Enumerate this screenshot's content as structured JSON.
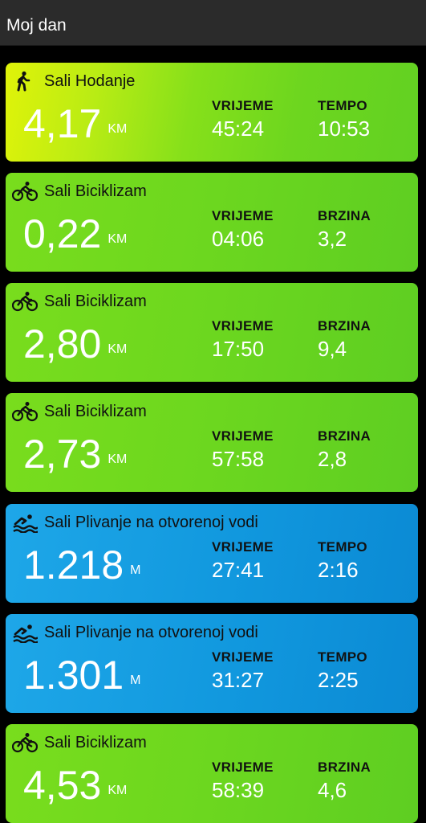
{
  "header": {
    "title": "Moj dan"
  },
  "activities": [
    {
      "type": "walk",
      "icon": "walking-icon",
      "name": "Sali Hodanje",
      "distance": "4,17",
      "unit": "KM",
      "stat1_label": "VRIJEME",
      "stat1_value": "45:24",
      "stat2_label": "TEMPO",
      "stat2_value": "10:53"
    },
    {
      "type": "bike",
      "icon": "cycling-icon",
      "name": "Sali Biciklizam",
      "distance": "0,22",
      "unit": "KM",
      "stat1_label": "VRIJEME",
      "stat1_value": "04:06",
      "stat2_label": "BRZINA",
      "stat2_value": "3,2"
    },
    {
      "type": "bike",
      "icon": "cycling-icon",
      "name": "Sali Biciklizam",
      "distance": "2,80",
      "unit": "KM",
      "stat1_label": "VRIJEME",
      "stat1_value": "17:50",
      "stat2_label": "BRZINA",
      "stat2_value": "9,4"
    },
    {
      "type": "bike",
      "icon": "cycling-icon",
      "name": "Sali Biciklizam",
      "distance": "2,73",
      "unit": "KM",
      "stat1_label": "VRIJEME",
      "stat1_value": "57:58",
      "stat2_label": "BRZINA",
      "stat2_value": "2,8"
    },
    {
      "type": "swim",
      "icon": "swimming-icon",
      "name": "Sali Plivanje na otvorenoj vodi",
      "distance": "1.218",
      "unit": "M",
      "stat1_label": "VRIJEME",
      "stat1_value": "27:41",
      "stat2_label": "TEMPO",
      "stat2_value": "2:16"
    },
    {
      "type": "swim",
      "icon": "swimming-icon",
      "name": "Sali Plivanje na otvorenoj vodi",
      "distance": "1.301",
      "unit": "M",
      "stat1_label": "VRIJEME",
      "stat1_value": "31:27",
      "stat2_label": "TEMPO",
      "stat2_value": "2:25"
    },
    {
      "type": "bike",
      "icon": "cycling-icon",
      "name": "Sali Biciklizam",
      "distance": "4,53",
      "unit": "KM",
      "stat1_label": "VRIJEME",
      "stat1_value": "58:39",
      "stat2_label": "BRZINA",
      "stat2_value": "4,6"
    }
  ],
  "colors": {
    "walk_accent": "#e0f309",
    "bike_green": "#6cd71f",
    "swim_blue": "#1198de",
    "background": "#000000",
    "header_bg": "#2b2b2b"
  }
}
